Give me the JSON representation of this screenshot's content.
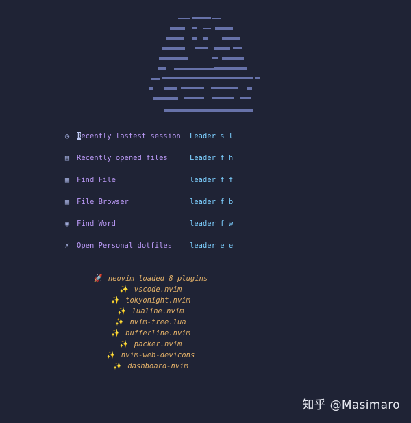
{
  "banner": {
    "icon": "neovim-ascii-logo",
    "color": "#6f7bb6"
  },
  "menu": [
    {
      "icon": "clock-icon",
      "glyph": "◷",
      "label": "Recently lastest session",
      "key": "Leader s l"
    },
    {
      "icon": "folder-icon",
      "glyph": "▤",
      "label": "Recently opened files",
      "key": "Leader f h"
    },
    {
      "icon": "file-icon",
      "glyph": "▦",
      "label": "Find File",
      "key": "leader f f"
    },
    {
      "icon": "file-browser-icon",
      "glyph": "▦",
      "label": "File Browser",
      "key": "leader f b"
    },
    {
      "icon": "search-icon",
      "glyph": "◉",
      "label": "Find Word",
      "key": "leader f w"
    },
    {
      "icon": "tools-icon",
      "glyph": "✗",
      "label": "Open Personal dotfiles",
      "key": "leader e e"
    }
  ],
  "footer": {
    "loaded_text": "neovim loaded 8 plugins",
    "loaded_icon": "rocket-icon",
    "plugins": [
      "vscode.nvim",
      "tokyonight.nvim",
      "lualine.nvim",
      "nvim-tree.lua",
      "bufferline.nvim",
      "packer.nvim",
      "nvim-web-devicons",
      "dashboard-nvim"
    ],
    "plugin_icon": "sparkles-icon"
  },
  "watermark": "知乎 @Masimaro",
  "colors": {
    "background": "#1f2335",
    "menu_label": "#bb9af7",
    "menu_key": "#7dcfff",
    "footer": "#e0af68"
  }
}
